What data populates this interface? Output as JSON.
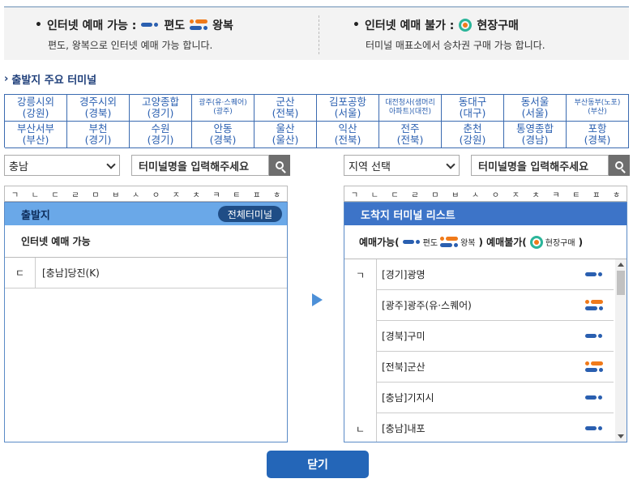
{
  "legend": {
    "online_ok": "인터넷 예매 가능 :",
    "oneway": "편도",
    "round": "왕복",
    "online_ok_desc": "편도, 왕복으로 인터넷 예매 가능 합니다.",
    "online_no": "인터넷 예매 불가 :",
    "onsite": "현장구매",
    "online_no_desc": "터미널 매표소에서 승차권 구매 가능 합니다."
  },
  "section_title": "출발지 주요 터미널",
  "terminals": [
    {
      "line1": "강릉시외",
      "line2": "(강원)",
      "small": false
    },
    {
      "line1": "경주시외",
      "line2": "(경북)",
      "small": false
    },
    {
      "line1": "고양종합",
      "line2": "(경기)",
      "small": false
    },
    {
      "line1": "광주(유·스퀘어)",
      "line2": "(광주)",
      "small": true
    },
    {
      "line1": "군산",
      "line2": "(전북)",
      "small": false
    },
    {
      "line1": "김포공항",
      "line2": "(서울)",
      "small": false
    },
    {
      "line1": "대전청사(샘머리",
      "line2": "아파트)(대전)",
      "small": true
    },
    {
      "line1": "동대구",
      "line2": "(대구)",
      "small": false
    },
    {
      "line1": "동서울",
      "line2": "(서울)",
      "small": false
    },
    {
      "line1": "부산동부(노포)",
      "line2": "(부산)",
      "small": true
    },
    {
      "line1": "부산서부",
      "line2": "(부산)",
      "small": false
    },
    {
      "line1": "부천",
      "line2": "(경기)",
      "small": false
    },
    {
      "line1": "수원",
      "line2": "(경기)",
      "small": false
    },
    {
      "line1": "안동",
      "line2": "(경북)",
      "small": false
    },
    {
      "line1": "울산",
      "line2": "(울산)",
      "small": false
    },
    {
      "line1": "익산",
      "line2": "(전북)",
      "small": false
    },
    {
      "line1": "전주",
      "line2": "(전북)",
      "small": false
    },
    {
      "line1": "춘천",
      "line2": "(강원)",
      "small": false
    },
    {
      "line1": "통영종합",
      "line2": "(경남)",
      "small": false
    },
    {
      "line1": "포항",
      "line2": "(경북)",
      "small": false
    }
  ],
  "left": {
    "region_select": "충남",
    "search_placeholder": "터미널명을 입력해주세요",
    "consonants": [
      "ㄱ",
      "ㄴ",
      "ㄷ",
      "ㄹ",
      "ㅁ",
      "ㅂ",
      "ㅅ",
      "ㅇ",
      "ㅈ",
      "ㅊ",
      "ㅋ",
      "ㅌ",
      "ㅍ",
      "ㅎ"
    ],
    "header": "출발지",
    "all_button": "전체터미널",
    "subhead": "인터넷 예매 가능",
    "rows": [
      {
        "initial": "ㄷ",
        "name": "[충남]당진(K)"
      }
    ]
  },
  "right": {
    "region_select": "지역 선택",
    "search_placeholder": "터미널명을 입력해주세요",
    "consonants": [
      "ㄱ",
      "ㄴ",
      "ㄷ",
      "ㄹ",
      "ㅁ",
      "ㅂ",
      "ㅅ",
      "ㅇ",
      "ㅈ",
      "ㅊ",
      "ㅋ",
      "ㅌ",
      "ㅍ",
      "ㅎ"
    ],
    "header": "도착지 터미널 리스트",
    "sub_ok": "예매가능(",
    "sub_oneway": "편도",
    "sub_round": "왕복",
    "sub_mid": ") 예매불가(",
    "sub_onsite": "현장구매",
    "sub_end": ")",
    "rows": [
      {
        "initial": "ㄱ",
        "name": "[경기]광명",
        "type": "oneway"
      },
      {
        "initial": "",
        "name": "[광주]광주(유·스퀘어)",
        "type": "round"
      },
      {
        "initial": "",
        "name": "[경북]구미",
        "type": "oneway"
      },
      {
        "initial": "",
        "name": "[전북]군산",
        "type": "round"
      },
      {
        "initial": "",
        "name": "[충남]기지시",
        "type": "oneway"
      },
      {
        "initial": "ㄴ",
        "name": "[충남]내포",
        "type": "oneway"
      }
    ]
  },
  "close_label": "닫기",
  "colors": {
    "accent": "#2466b8",
    "oneway": "#2a5fb0",
    "round_top": "#f07a1a",
    "onsite_ring": "#2bb59a"
  }
}
